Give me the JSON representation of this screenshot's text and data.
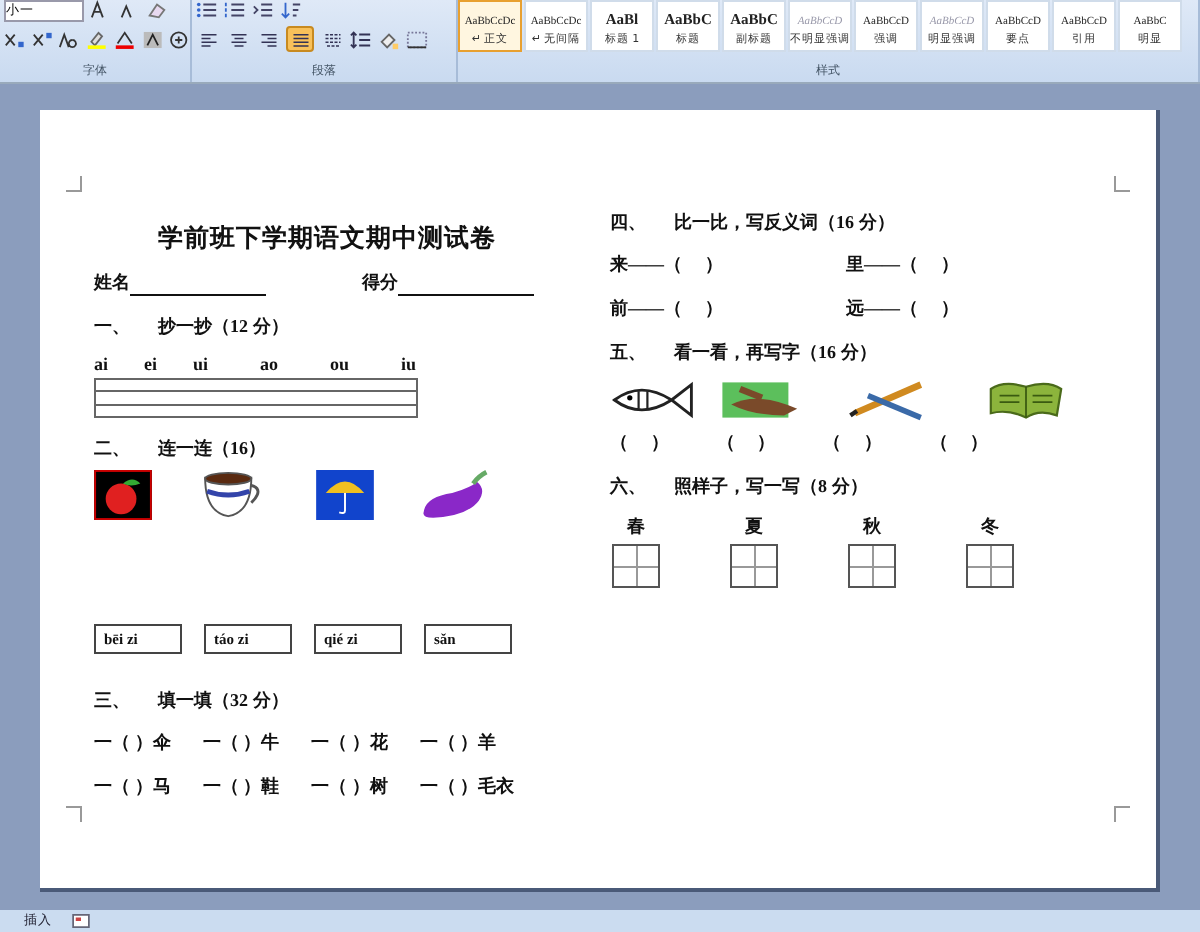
{
  "ribbon": {
    "font_size": "小一",
    "align_buttons": [
      {
        "kind": "left",
        "selected": false
      },
      {
        "kind": "center",
        "selected": false
      },
      {
        "kind": "right",
        "selected": false
      },
      {
        "kind": "justify",
        "selected": true
      },
      {
        "kind": "distributed",
        "selected": false
      }
    ],
    "styles": [
      {
        "preview": "AaBbCcDc",
        "label": "↵ 正文",
        "selected": true
      },
      {
        "preview": "AaBbCcDc",
        "label": "↵ 无间隔",
        "selected": false
      },
      {
        "preview": "AaBl",
        "label": "标题 1",
        "selected": false
      },
      {
        "preview": "AaBbC",
        "label": "标题",
        "selected": false
      },
      {
        "preview": "AaBbC",
        "label": "副标题",
        "selected": false
      },
      {
        "preview": "AaBbCcD",
        "label": "不明显强调",
        "selected": false
      },
      {
        "preview": "AaBbCcD",
        "label": "强调",
        "selected": false
      },
      {
        "preview": "AaBbCcD",
        "label": "明显强调",
        "selected": false
      },
      {
        "preview": "AaBbCcD",
        "label": "要点",
        "selected": false
      },
      {
        "preview": "AaBbCcD",
        "label": "引用",
        "selected": false
      },
      {
        "preview": "AaBbC",
        "label": "明显",
        "selected": false
      }
    ],
    "groups": [
      "字体",
      "段落",
      "样式"
    ]
  },
  "document": {
    "title": "学前班下学期语文期中测试卷",
    "name_label": "姓名",
    "score_label": "得分",
    "left": [
      {
        "num": "一、",
        "title": "抄一抄（12 分）",
        "pinyin": [
          "ai",
          "ei",
          "ui",
          "ao",
          "ou",
          "iu"
        ]
      },
      {
        "num": "二、",
        "title": "连一连（16）",
        "pinyin_boxes": [
          "bēi zi",
          "táo zi",
          "qié zi",
          "sǎn"
        ]
      },
      {
        "num": "三、",
        "title": "填一填（32 分）",
        "rows": [
          [
            "一（ ）伞",
            "一（ ）牛",
            "一（ ）花",
            "一（ ）羊"
          ],
          [
            "一（ ）马",
            "一（ ）鞋",
            "一（ ）树",
            "一（ ）毛衣"
          ]
        ]
      }
    ],
    "right": [
      {
        "num": "四、",
        "title": "比一比，写反义词（16 分）",
        "pairs": [
          "来——（　 ）",
          "里——（　 ）",
          "前——（　 ）",
          "远——（　 ）"
        ]
      },
      {
        "num": "五、",
        "title": "看一看，再写字（16 分）",
        "blanks": [
          "（　 ）",
          "（　 ）",
          "（　 ）",
          "（　 ）"
        ]
      },
      {
        "num": "六、",
        "title": "照样子，写一写（8 分）",
        "chars": [
          "春",
          "夏",
          "秋",
          "冬"
        ]
      }
    ]
  },
  "status_bar": {
    "mode": "插入"
  }
}
